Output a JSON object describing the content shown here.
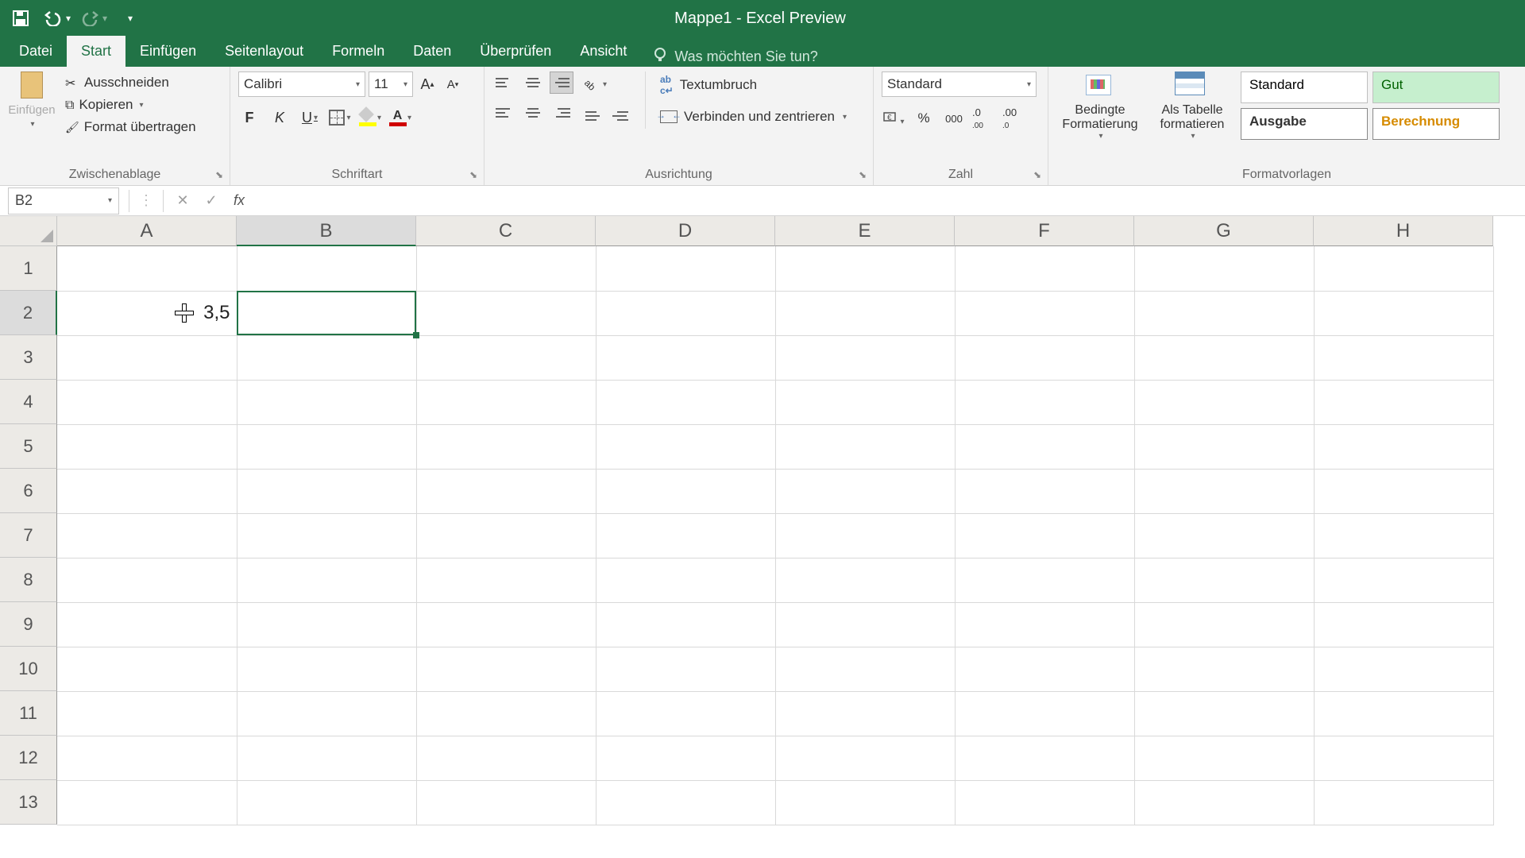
{
  "title": "Mappe1  -  Excel Preview",
  "tabs": {
    "datei": "Datei",
    "start": "Start",
    "einfugen": "Einfügen",
    "seitenlayout": "Seitenlayout",
    "formeln": "Formeln",
    "daten": "Daten",
    "uberprufen": "Überprüfen",
    "ansicht": "Ansicht",
    "tellme": "Was möchten Sie tun?"
  },
  "clipboard": {
    "paste": "Einfügen",
    "cut": "Ausschneiden",
    "copy": "Kopieren",
    "format": "Format übertragen",
    "group": "Zwischenablage"
  },
  "font": {
    "name": "Calibri",
    "size": "11",
    "group": "Schriftart",
    "bold": "F",
    "italic": "K",
    "underline": "U",
    "fontcolor_letter": "A"
  },
  "align": {
    "wrap": "Textumbruch",
    "merge": "Verbinden und zentrieren",
    "group": "Ausrichtung"
  },
  "number": {
    "format": "Standard",
    "group": "Zahl",
    "percent": "%",
    "thousand": "000"
  },
  "styles": {
    "cond": "Bedingte Formatierung",
    "table": "Als Tabelle formatieren",
    "standard": "Standard",
    "gut": "Gut",
    "ausgabe": "Ausgabe",
    "berechnung": "Berechnung",
    "group": "Formatvorlagen"
  },
  "namebox": "B2",
  "formula": "",
  "columns": [
    "A",
    "B",
    "C",
    "D",
    "E",
    "F",
    "G",
    "H"
  ],
  "rows": [
    "1",
    "2",
    "3",
    "4",
    "5",
    "6",
    "7",
    "8",
    "9",
    "10",
    "11",
    "12",
    "13"
  ],
  "selected_col_index": 1,
  "selected_row_index": 1,
  "cell_A2": "3,5"
}
